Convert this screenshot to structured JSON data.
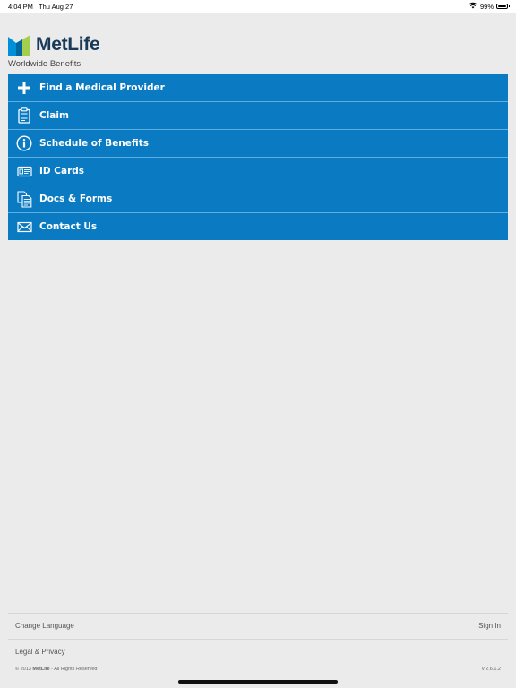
{
  "status_bar": {
    "time": "4:04 PM",
    "date": "Thu Aug 27",
    "battery_text": "99%",
    "battery_level": 0.99
  },
  "brand": {
    "name": "MetLife",
    "subtitle": "Worldwide Benefits",
    "colors": {
      "blue": "#0090da",
      "green": "#a4ce4e",
      "dark": "#1a3a5a"
    }
  },
  "menu": {
    "accent_color": "#0a7bc2",
    "items": [
      {
        "label": "Find a Medical Provider",
        "icon": "plus-icon"
      },
      {
        "label": "Claim",
        "icon": "clipboard-icon"
      },
      {
        "label": "Schedule of Benefits",
        "icon": "info-icon"
      },
      {
        "label": "ID Cards",
        "icon": "id-card-icon"
      },
      {
        "label": "Docs & Forms",
        "icon": "documents-icon"
      },
      {
        "label": "Contact Us",
        "icon": "envelope-icon"
      }
    ]
  },
  "footer": {
    "change_language": "Change Language",
    "sign_in": "Sign In",
    "legal_privacy": "Legal & Privacy",
    "copyright_prefix": "© 2013",
    "copyright_brand": "MetLife",
    "copyright_suffix": "- All Rights Reserved",
    "version": "v 2.6.1.2"
  }
}
